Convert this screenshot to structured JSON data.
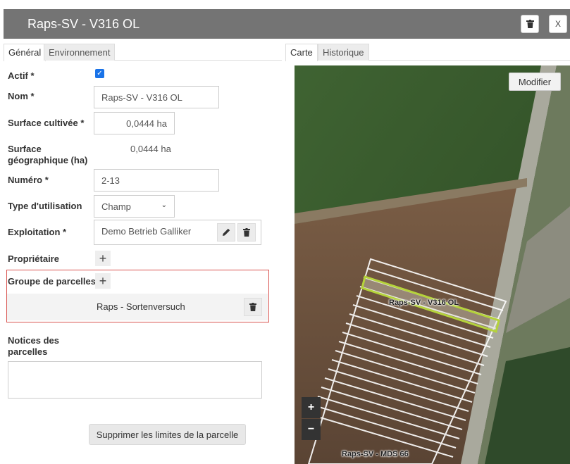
{
  "header": {
    "title": "Raps-SV - V316 OL",
    "close_label": "X",
    "delete_icon": "trash-icon"
  },
  "left_tabs": [
    {
      "label": "Général",
      "active": true
    },
    {
      "label": "Environnement",
      "active": false
    }
  ],
  "right_tabs": [
    {
      "label": "Carte",
      "active": true
    },
    {
      "label": "Historique",
      "active": false
    }
  ],
  "form": {
    "actif": {
      "label": "Actif *",
      "checked": true
    },
    "nom": {
      "label": "Nom *",
      "value": "Raps-SV - V316 OL"
    },
    "surface_cultivee": {
      "label": "Surface cultivée *",
      "value": "0,0444 ha"
    },
    "surface_geo": {
      "label_line1": "Surface",
      "label_line2": "géographique (ha)",
      "value": "0,0444 ha"
    },
    "numero": {
      "label": "Numéro *",
      "value": "2-13"
    },
    "type_utilisation": {
      "label": "Type d'utilisation",
      "value": "Champ"
    },
    "exploitation": {
      "label": "Exploitation *",
      "value": "Demo Betrieb Galliker"
    },
    "proprietaire": {
      "label": "Propriétaire"
    },
    "groupe": {
      "label": "Groupe de parcelles",
      "item": "Raps - Sortenversuch"
    },
    "notices": {
      "label_line1": "Notices des",
      "label_line2": "parcelles",
      "value": ""
    },
    "delete_bounds_label": "Supprimer les limites de la parcelle"
  },
  "map": {
    "modifier_label": "Modifier",
    "zoom_in": "+",
    "zoom_out": "−",
    "labels": {
      "parcel": "Raps-SV - V316 OL",
      "parcel_bottom": "Raps-SV - MDS 66"
    },
    "colors": {
      "selected_parcel": "#b5d33b",
      "grid_lines": "#ffffff",
      "field": "#3a5c2e"
    }
  }
}
